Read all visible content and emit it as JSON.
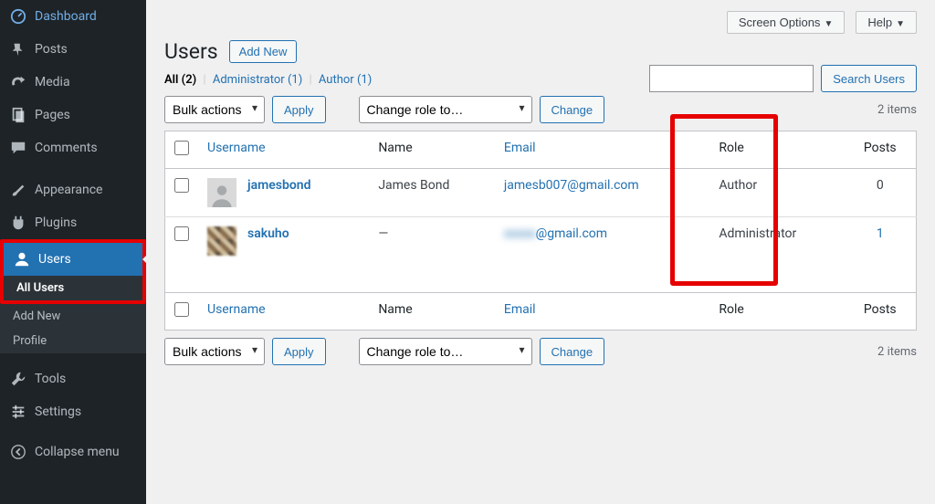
{
  "sidebar": {
    "items": [
      {
        "icon": "dashboard",
        "label": "Dashboard"
      },
      {
        "icon": "pin",
        "label": "Posts"
      },
      {
        "icon": "media",
        "label": "Media"
      },
      {
        "icon": "pages",
        "label": "Pages"
      },
      {
        "icon": "comments",
        "label": "Comments"
      },
      {
        "icon": "appearance",
        "label": "Appearance"
      },
      {
        "icon": "plugins",
        "label": "Plugins"
      },
      {
        "icon": "users",
        "label": "Users",
        "current": true
      },
      {
        "icon": "tools",
        "label": "Tools"
      },
      {
        "icon": "settings",
        "label": "Settings"
      }
    ],
    "submenu": [
      "All Users",
      "Add New",
      "Profile"
    ],
    "collapse": "Collapse menu"
  },
  "topbar": {
    "screen_options": "Screen Options",
    "help": "Help"
  },
  "page": {
    "title": "Users",
    "add_new": "Add New"
  },
  "filters": {
    "all_label": "All",
    "all_count": "(2)",
    "admin_label": "Administrator",
    "admin_count": "(1)",
    "author_label": "Author",
    "author_count": "(1)"
  },
  "search": {
    "button": "Search Users"
  },
  "bulk": {
    "bulk_label": "Bulk actions",
    "apply": "Apply",
    "role_label": "Change role to…",
    "change": "Change",
    "items": "2 items"
  },
  "cols": {
    "username": "Username",
    "name": "Name",
    "email": "Email",
    "role": "Role",
    "posts": "Posts"
  },
  "rows": [
    {
      "username": "jamesbond",
      "name": "James Bond",
      "email": "jamesb007@gmail.com",
      "email_blur": false,
      "role": "Author",
      "posts": "0",
      "posts_link": false,
      "avatar_pix": false
    },
    {
      "username": "sakuho",
      "name": "—",
      "email_prefix": "xxxxx",
      "email_suffix": "@gmail.com",
      "email_blur": true,
      "role": "Administrator",
      "posts": "1",
      "posts_link": true,
      "avatar_pix": true
    }
  ]
}
